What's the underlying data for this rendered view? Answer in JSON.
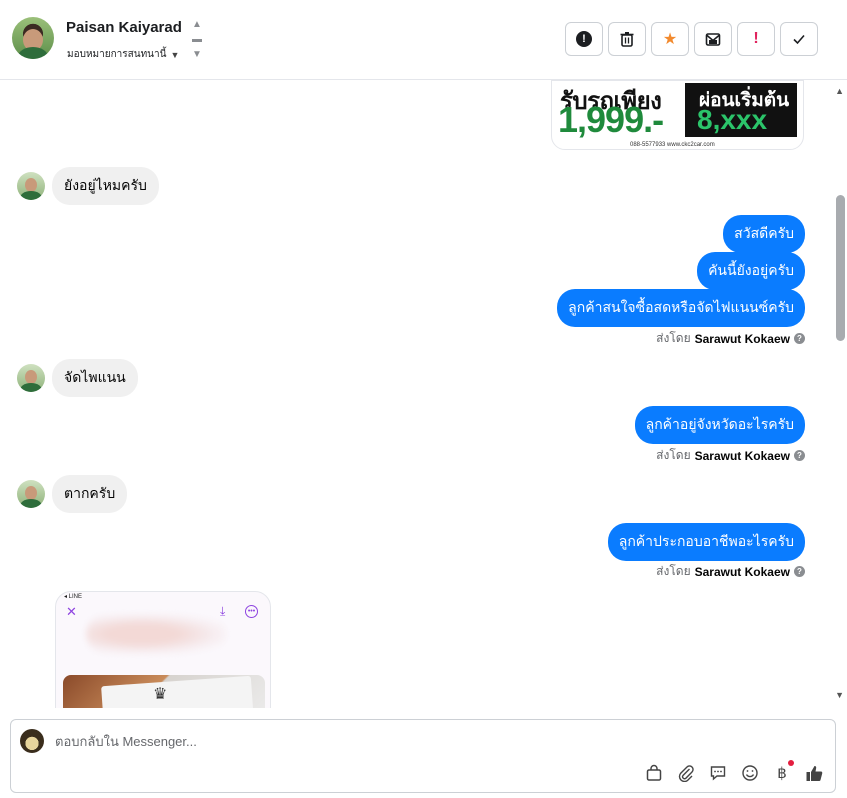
{
  "header": {
    "contact_name": "Paisan Kaiyarad",
    "assign_label": "มอบหมายการสนทนานี้"
  },
  "toolbar": {
    "icons": [
      "spam-icon",
      "trash-icon",
      "star-icon",
      "mark-unread-icon",
      "follow-up-icon",
      "done-check-icon"
    ]
  },
  "ad": {
    "headline": "รับรถเพียง",
    "price": "1,999.-",
    "installment_label": "ผ่อนเริ่มต้น",
    "installment_value": "8,xxx",
    "footer": "088-5577933 www.ckc2car.com"
  },
  "messages": {
    "in_1": "ยังอยู่ไหมครับ",
    "out_1": "สวัสดีครับ",
    "out_2": "คันนี้ยังอยู่ครับ",
    "out_3": "ลูกค้าสนใจซื้อสดหรือจัดไฟแนนซ์ครับ",
    "in_2": "จัดไพแนน",
    "out_4": "ลูกค้าอยู่จังหวัดอะไรครับ",
    "in_3": "ตากครับ",
    "out_5": "ลูกค้าประกอบอาชีพอะไรครับ"
  },
  "sent_by": {
    "prefix": "ส่งโดย",
    "agent": "Sarawut Kokaew"
  },
  "attachment": {
    "status_text": "◂ LINE"
  },
  "composer": {
    "placeholder": "ตอบกลับใน Messenger..."
  }
}
